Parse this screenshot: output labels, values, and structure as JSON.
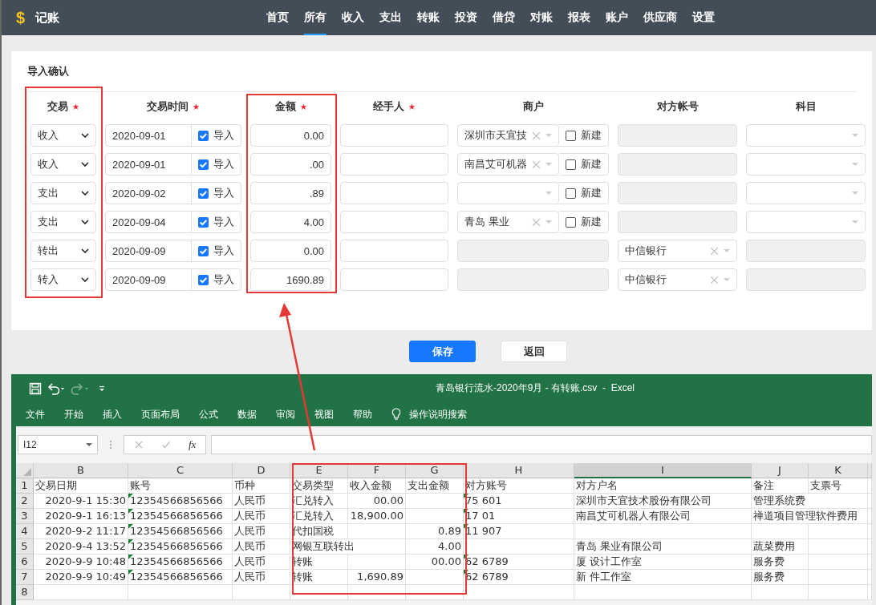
{
  "app": {
    "logo": "$",
    "title": "记账",
    "nav": [
      {
        "label": "首页",
        "selected": false
      },
      {
        "label": "所有",
        "selected": true
      },
      {
        "label": "收入",
        "selected": false
      },
      {
        "label": "支出",
        "selected": false
      },
      {
        "label": "转账",
        "selected": false
      },
      {
        "label": "投资",
        "selected": false
      },
      {
        "label": "借贷",
        "selected": false
      },
      {
        "label": "对账",
        "selected": false
      },
      {
        "label": "报表",
        "selected": false
      },
      {
        "label": "账户",
        "selected": false
      },
      {
        "label": "供应商",
        "selected": false
      },
      {
        "label": "设置",
        "selected": false
      }
    ]
  },
  "card": {
    "title": "导入确认",
    "columns": [
      {
        "label": "交易",
        "required": true
      },
      {
        "label": "交易时间",
        "required": true
      },
      {
        "label": "金额",
        "required": true
      },
      {
        "label": "经手人",
        "required": true
      },
      {
        "label": "商户",
        "required": false
      },
      {
        "label": "对方帐号",
        "required": false
      },
      {
        "label": "科目",
        "required": false
      }
    ],
    "rows": [
      {
        "type": "收入",
        "date": "2020-09-01",
        "import_label": "导入",
        "import_checked": true,
        "amount": "0.00",
        "merchant": {
          "kind": "select",
          "value": "深圳市天宜技",
          "clearable": true,
          "new_label": "新建",
          "new_checked": false
        },
        "account": {
          "kind": "disabled"
        },
        "subject": {
          "kind": "select"
        }
      },
      {
        "type": "收入",
        "date": "2020-09-01",
        "import_label": "导入",
        "import_checked": true,
        "amount": ".00",
        "merchant": {
          "kind": "select",
          "value": "南昌艾可机器",
          "clearable": true,
          "new_label": "新建",
          "new_checked": false
        },
        "account": {
          "kind": "disabled"
        },
        "subject": {
          "kind": "select"
        }
      },
      {
        "type": "支出",
        "date": "2020-09-02",
        "import_label": "导入",
        "import_checked": true,
        "amount": ".89",
        "merchant": {
          "kind": "select",
          "clearable": false,
          "new_label": "新建",
          "new_checked": false
        },
        "account": {
          "kind": "disabled"
        },
        "subject": {
          "kind": "select"
        }
      },
      {
        "type": "支出",
        "date": "2020-09-04",
        "import_label": "导入",
        "import_checked": true,
        "amount": "4.00",
        "merchant": {
          "kind": "select",
          "value": "青岛 果业",
          "clearable": true,
          "new_label": "新建",
          "new_checked": false
        },
        "account": {
          "kind": "disabled"
        },
        "subject": {
          "kind": "select"
        }
      },
      {
        "type": "转出",
        "date": "2020-09-09",
        "import_label": "导入",
        "import_checked": true,
        "amount": "0.00",
        "merchant": {
          "kind": "disabled"
        },
        "account": {
          "kind": "select",
          "value": "中信银行",
          "clearable": true
        },
        "subject": {
          "kind": "disabled"
        }
      },
      {
        "type": "转入",
        "date": "2020-09-09",
        "import_label": "导入",
        "import_checked": true,
        "amount": "1690.89",
        "merchant": {
          "kind": "disabled"
        },
        "account": {
          "kind": "select",
          "value": "中信银行",
          "clearable": true
        },
        "subject": {
          "kind": "disabled"
        }
      }
    ]
  },
  "buttons": [
    {
      "label": "保存",
      "kind": "primary"
    },
    {
      "label": "返回",
      "kind": "default"
    }
  ],
  "excel": {
    "title": "青岛银行流水-2020年9月 - 有转账.csv  -  Excel",
    "tabs": [
      "文件",
      "开始",
      "插入",
      "页面布局",
      "公式",
      "数据",
      "审阅",
      "视图",
      "帮助"
    ],
    "search_hint": "操作说明搜索",
    "name_box": "I12",
    "fx_label": "fx",
    "columns": [
      {
        "label": "B",
        "selected": false
      },
      {
        "label": "C",
        "selected": false
      },
      {
        "label": "D",
        "selected": false
      },
      {
        "label": "E",
        "selected": false
      },
      {
        "label": "F",
        "selected": false
      },
      {
        "label": "G",
        "selected": false
      },
      {
        "label": "H",
        "selected": false
      },
      {
        "label": "I",
        "selected": true
      },
      {
        "label": "J",
        "selected": false
      },
      {
        "label": "K",
        "selected": false
      }
    ],
    "rows": [
      {
        "number": "1",
        "cells": [
          "交易日期",
          "账号",
          "币种",
          "交易类型",
          "收入金额",
          "支出金额",
          "对方账号",
          "对方户名",
          "备注",
          "支票号"
        ]
      },
      {
        "number": "2",
        "cells": [
          {
            "text": "2020-9-1 15:30",
            "kind": "number"
          },
          {
            "text": "12354566856566",
            "kind": "flagged"
          },
          "人民币",
          "汇兑转入",
          {
            "text": "00.00",
            "kind": "number"
          },
          "",
          {
            "text": "75        601",
            "kind": "flagged"
          },
          "深圳市天宜技术股份有限公司",
          "管理系统费",
          ""
        ]
      },
      {
        "number": "3",
        "cells": [
          {
            "text": "2020-9-1 16:13",
            "kind": "number"
          },
          {
            "text": "12354566856566",
            "kind": "flagged"
          },
          "人民币",
          "汇兑转入",
          {
            "text": "18,900.00",
            "kind": "number"
          },
          "",
          {
            "text": "17        01",
            "kind": "flagged"
          },
          "南昌艾可机器人有限公司",
          "禅道项目管理软件费用",
          ""
        ]
      },
      {
        "number": "4",
        "cells": [
          {
            "text": "2020-9-2 11:17",
            "kind": "number"
          },
          {
            "text": "12354566856566",
            "kind": "flagged"
          },
          "人民币",
          "代扣国税",
          "",
          {
            "text": "0.89",
            "kind": "number"
          },
          {
            "text": "11        907",
            "kind": "flagged"
          },
          "",
          "",
          ""
        ]
      },
      {
        "number": "5",
        "cells": [
          {
            "text": "2020-9-4 13:52",
            "kind": "number"
          },
          {
            "text": "12354566856566",
            "kind": "flagged"
          },
          "人民币",
          "网银互联转出",
          "",
          {
            "text": "4.00",
            "kind": "number"
          },
          "",
          "青岛 果业有限公司",
          "蔬菜费用",
          ""
        ]
      },
      {
        "number": "6",
        "cells": [
          {
            "text": "2020-9-9 10:48",
            "kind": "number"
          },
          {
            "text": "12354566856566",
            "kind": "flagged"
          },
          "人民币",
          "转账",
          "",
          {
            "text": "00.00",
            "kind": "number"
          },
          {
            "text": "62        6789",
            "kind": "flagged"
          },
          "厦 设计工作室",
          "服务费",
          ""
        ]
      },
      {
        "number": "7",
        "cells": [
          {
            "text": "2020-9-9 10:49",
            "kind": "number"
          },
          {
            "text": "12354566856566",
            "kind": "flagged"
          },
          "人民币",
          "转账",
          {
            "text": "1,690.89",
            "kind": "number"
          },
          "",
          {
            "text": "62        6789",
            "kind": "flagged"
          },
          "新 件工作室",
          "服务费",
          ""
        ]
      },
      {
        "number": "8",
        "cells": [
          "",
          "",
          "",
          "",
          "",
          "",
          "",
          "",
          "",
          ""
        ]
      }
    ]
  }
}
